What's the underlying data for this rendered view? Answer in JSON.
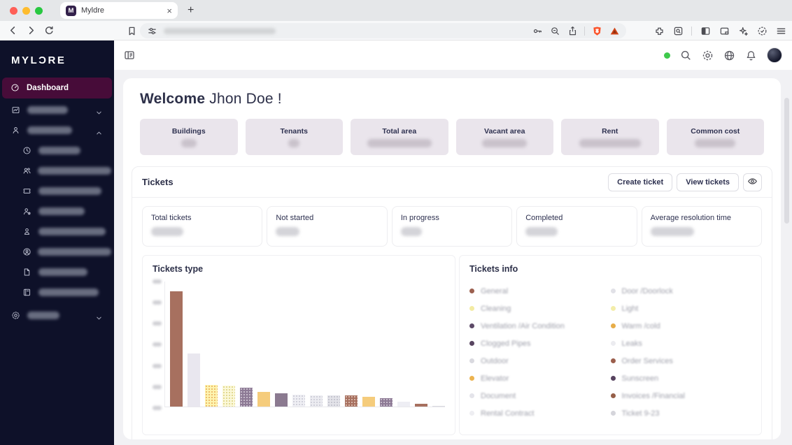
{
  "browser": {
    "tab_title": "Myldre",
    "favicon_letter": "M",
    "close_tab": "×",
    "new_tab": "+",
    "url_redacted": true,
    "traffic_light_colors": [
      "#ff5f57",
      "#febc2e",
      "#28c840"
    ],
    "toolbar_icon_names": [
      "back-icon",
      "forward-icon",
      "reload-icon",
      "bookmark-icon",
      "tune-icon",
      "key-icon",
      "zoom-out-icon",
      "share-icon",
      "brave-shield-icon",
      "brave-rewards-icon",
      "extensions-icon",
      "search-tabs-icon",
      "sidebar-toggle-icon",
      "wallet-icon",
      "leo-sparkle-icon",
      "vpn-shield-icon",
      "menu-icon"
    ]
  },
  "sidebar": {
    "logo": "MYLƆRE",
    "items": [
      {
        "id": "dashboard",
        "label": "Dashboard",
        "icon": "dashboard-icon",
        "active": true
      },
      {
        "id": "redacted-group-1",
        "redacted": true,
        "icon": "chart-image-icon",
        "chevron": "down",
        "blob_width": 58,
        "indent": 0
      },
      {
        "id": "redacted-group-2",
        "redacted": true,
        "icon": "person-icon",
        "chevron": "up",
        "blob_width": 64,
        "indent": 0
      },
      {
        "id": "redacted-sub-1",
        "redacted": true,
        "icon": "clock-icon",
        "blob_width": 60,
        "indent": 1
      },
      {
        "id": "redacted-sub-2",
        "redacted": true,
        "icon": "users-icon",
        "blob_width": 112,
        "indent": 1
      },
      {
        "id": "redacted-sub-3",
        "redacted": true,
        "icon": "ticket-icon",
        "blob_width": 90,
        "indent": 1
      },
      {
        "id": "redacted-sub-4",
        "redacted": true,
        "icon": "person-star-icon",
        "blob_width": 66,
        "indent": 1
      },
      {
        "id": "redacted-sub-5",
        "redacted": true,
        "icon": "person-outline-icon",
        "blob_width": 96,
        "indent": 1
      },
      {
        "id": "redacted-sub-6",
        "redacted": true,
        "icon": "person-circle-icon",
        "blob_width": 116,
        "indent": 1
      },
      {
        "id": "redacted-sub-7",
        "redacted": true,
        "icon": "document-icon",
        "blob_width": 70,
        "indent": 1
      },
      {
        "id": "redacted-sub-8",
        "redacted": true,
        "icon": "book-icon",
        "blob_width": 86,
        "indent": 1
      },
      {
        "id": "settings",
        "redacted": true,
        "icon": "gear-icon",
        "chevron": "down",
        "blob_width": 46,
        "indent": 0,
        "gap_before": true
      }
    ]
  },
  "topbar": {
    "status_color": "#3fc94c",
    "icon_names": [
      "search-icon",
      "gear-icon",
      "globe-icon",
      "bell-icon",
      "avatar"
    ]
  },
  "main": {
    "welcome_bold": "Welcome",
    "welcome_rest": " Jhon Doe !",
    "summary_cards": [
      {
        "title": "Buildings",
        "value_redacted": true,
        "blob_width": 22
      },
      {
        "title": "Tenants",
        "value_redacted": true,
        "blob_width": 16
      },
      {
        "title": "Total area",
        "value_redacted": true,
        "blob_width": 92
      },
      {
        "title": "Vacant area",
        "value_redacted": true,
        "blob_width": 64
      },
      {
        "title": "Rent",
        "value_redacted": true,
        "blob_width": 88
      },
      {
        "title": "Common cost",
        "value_redacted": true,
        "blob_width": 58
      }
    ],
    "tickets": {
      "title": "Tickets",
      "create_button": "Create ticket",
      "view_button": "View tickets",
      "stat_cards": [
        {
          "title": "Total tickets",
          "value_redacted": true,
          "blob_width": 46
        },
        {
          "title": "Not started",
          "value_redacted": true,
          "blob_width": 34
        },
        {
          "title": "In progress",
          "value_redacted": true,
          "blob_width": 30
        },
        {
          "title": "Completed",
          "value_redacted": true,
          "blob_width": 46
        },
        {
          "title": "Average resolution time",
          "value_redacted": true,
          "blob_width": 62
        }
      ],
      "chart_title": "Tickets type",
      "legend_title": "Tickets info"
    }
  },
  "chart_data": {
    "type": "bar",
    "title": "Tickets type",
    "y_axis": {
      "min": 0,
      "max": 600,
      "step": 100,
      "tick_labels_redacted": true
    },
    "grid": false,
    "bars": [
      {
        "value": 550,
        "color": "#a7705f"
      },
      {
        "value": 255,
        "color": "#e9e7ef"
      },
      {
        "value": 105,
        "color": "#fdf4b0",
        "dot": "#e9aa52"
      },
      {
        "value": 100,
        "color": "#fbf8d8",
        "dot": "#d9cf79"
      },
      {
        "value": 90,
        "color": "#8d7a95",
        "dot": "#d8d0dc"
      },
      {
        "value": 70,
        "color": "#f5cc7c"
      },
      {
        "value": 62,
        "color": "#8b7a90"
      },
      {
        "value": 58,
        "color": "#efeff4",
        "dot": "#c6c6d2"
      },
      {
        "value": 55,
        "color": "#ececf1",
        "dot": "#c6c6d2"
      },
      {
        "value": 52,
        "color": "#e3e3e9",
        "dot": "#bcbcc8"
      },
      {
        "value": 55,
        "color": "#a7705f",
        "dot": "#e6cdc2"
      },
      {
        "value": 48,
        "color": "#f5cc7c"
      },
      {
        "value": 40,
        "color": "#8d7a95",
        "dot": "#d8d0dc"
      },
      {
        "value": 22,
        "color": "#eeeef4"
      },
      {
        "value": 12,
        "color": "#a7705f"
      },
      {
        "value": 3,
        "color": "#dadae0"
      }
    ],
    "legend": {
      "title": "Tickets info",
      "text_blurred": true,
      "columns": [
        [
          {
            "label": "General",
            "color": "#9c604f"
          },
          {
            "label": "Cleaning",
            "color": "#f3eba3"
          },
          {
            "label": "Ventilation /Air Condition",
            "color": "#5d4a68"
          },
          {
            "label": "Clogged Pipes",
            "color": "#584560"
          },
          {
            "label": "Outdoor",
            "color": "#d9d9df"
          },
          {
            "label": "Elevator",
            "color": "#ecb34f"
          },
          {
            "label": "Document",
            "color": "#e4e4ea"
          },
          {
            "label": "Rental Contract",
            "color": "#eeeef2"
          }
        ],
        [
          {
            "label": "Door /Doorlock",
            "color": "#e1e1e7"
          },
          {
            "label": "Light",
            "color": "#f3eda9"
          },
          {
            "label": "Warm /cold",
            "color": "#e7ad48"
          },
          {
            "label": "Leaks",
            "color": "#ececf0"
          },
          {
            "label": "Order Services",
            "color": "#9b5e4c"
          },
          {
            "label": "Sunscreen",
            "color": "#57435f"
          },
          {
            "label": "Invoices /Financial",
            "color": "#965f49"
          },
          {
            "label": "Ticket 9-23",
            "color": "#d5d5db"
          }
        ]
      ]
    }
  }
}
